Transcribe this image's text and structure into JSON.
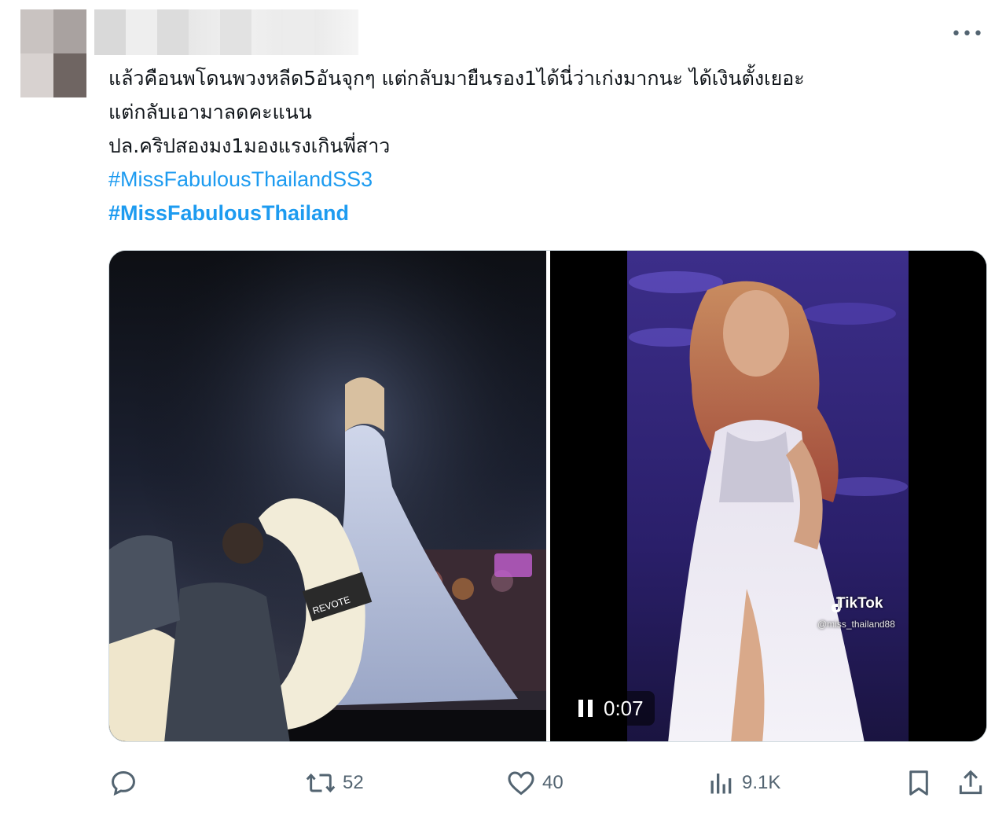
{
  "post": {
    "more_label": "•••",
    "text_lines": [
      "แล้วคือนพโดนพวงหลีด5อันจุกๆ แต่กลับมายืนรอง1ได้นี่ว่าเก่งมากนะ ได้เงินตั้งเยอะ",
      "แต่กลับเอามาลดคะแนน",
      "ปล.คริปสองมง1มองแรงเกินพี่สาว"
    ],
    "hashtags": [
      "#MissFabulousThailandSS3",
      "#MissFabulousThailand"
    ]
  },
  "media": {
    "video_time": "0:07",
    "watermark_brand": "TikTok",
    "watermark_user": "@miss_thailand88",
    "left_banner_text": "REVOTE"
  },
  "actions": {
    "reply_count": "",
    "retweet_count": "52",
    "like_count": "40",
    "views_count": "9.1K"
  },
  "colors": {
    "hashtag": "#1d9bf0",
    "icon_gray": "#536471",
    "text": "#0f1419"
  }
}
